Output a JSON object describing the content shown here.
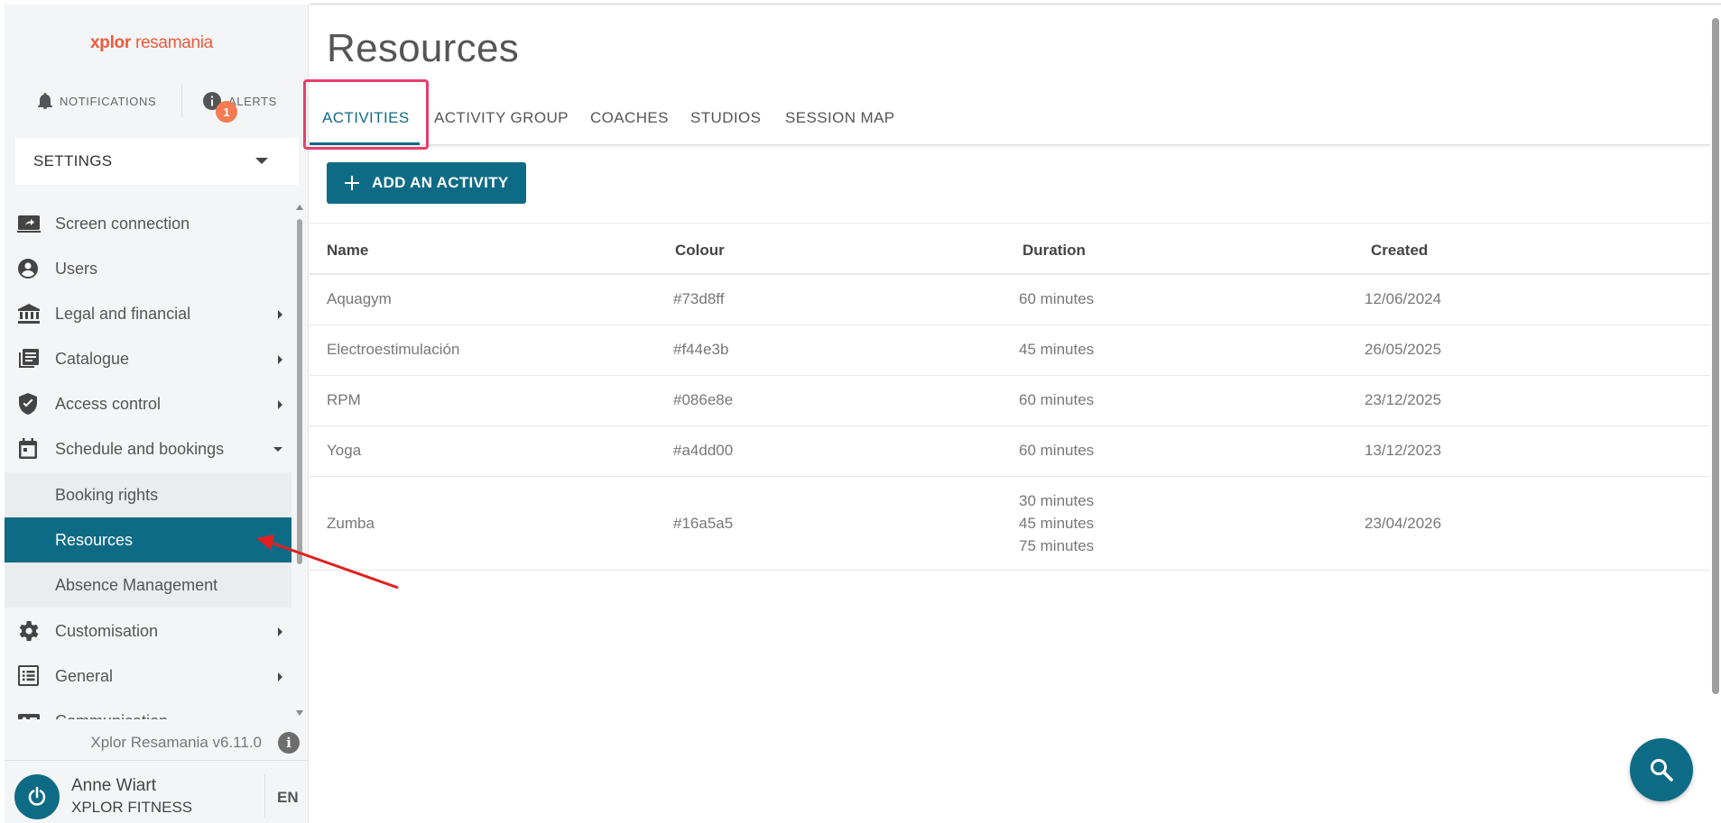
{
  "brand": {
    "logo_mark": "xplor",
    "logo_name": "resamania"
  },
  "sidebar": {
    "notifications_label": "NOTIFICATIONS",
    "alerts_label": "ALERTS",
    "alerts_count": "1",
    "settings_select": "SETTINGS",
    "items": [
      {
        "label": "Screen connection",
        "icon": "screen-share-icon"
      },
      {
        "label": "Users",
        "icon": "user-circle-icon"
      },
      {
        "label": "Legal and financial",
        "icon": "bank-icon"
      },
      {
        "label": "Catalogue",
        "icon": "catalogue-icon"
      },
      {
        "label": "Access control",
        "icon": "shield-check-icon"
      },
      {
        "label": "Schedule and bookings",
        "icon": "calendar-icon"
      },
      {
        "label": "Customisation",
        "icon": "gear-icon"
      },
      {
        "label": "General",
        "icon": "list-icon"
      },
      {
        "label": "Communication",
        "icon": "contact-card-icon"
      }
    ],
    "subitems": [
      {
        "label": "Booking rights"
      },
      {
        "label": "Resources"
      },
      {
        "label": "Absence Management"
      }
    ],
    "version": "Xplor Resamania v6.11.0",
    "user_name": "Anne Wiart",
    "user_org": "XPLOR FITNESS",
    "language": "EN"
  },
  "main": {
    "title": "Resources",
    "tabs": [
      {
        "label": "ACTIVITIES"
      },
      {
        "label": "ACTIVITY GROUP"
      },
      {
        "label": "COACHES"
      },
      {
        "label": "STUDIOS"
      },
      {
        "label": "SESSION MAP"
      }
    ],
    "add_button": "ADD AN ACTIVITY",
    "columns": [
      "Name",
      "Colour",
      "Duration",
      "Created"
    ],
    "rows": [
      {
        "name": "Aquagym",
        "colour": "#73d8ff",
        "durations": [
          "60 minutes"
        ],
        "created": "12/06/2024"
      },
      {
        "name": "Electroestimulación",
        "colour": "#f44e3b",
        "durations": [
          "45 minutes"
        ],
        "created": "26/05/2025"
      },
      {
        "name": "RPM",
        "colour": "#086e8e",
        "durations": [
          "60 minutes"
        ],
        "created": "23/12/2025"
      },
      {
        "name": "Yoga",
        "colour": "#a4dd00",
        "durations": [
          "60 minutes"
        ],
        "created": "13/12/2023"
      },
      {
        "name": "Zumba",
        "colour": "#16a5a5",
        "durations": [
          "30 minutes",
          "45 minutes",
          "75 minutes"
        ],
        "created": "23/04/2026"
      }
    ]
  },
  "colors": {
    "primary": "#0e6b86",
    "accent": "#ef5a3c",
    "badge": "#f47b52",
    "highlight": "#e63e6d",
    "annotation_arrow": "#e02020"
  }
}
